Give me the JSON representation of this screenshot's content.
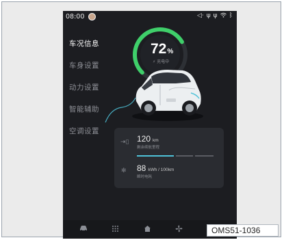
{
  "status_bar": {
    "time": "08:00",
    "icons": [
      "volume-icon",
      "usb-icon",
      "usb-icon",
      "wifi-icon",
      "bluetooth-icon"
    ]
  },
  "sidebar": {
    "items": [
      {
        "label": "车况信息",
        "active": true
      },
      {
        "label": "车身设置",
        "active": false
      },
      {
        "label": "动力设置",
        "active": false
      },
      {
        "label": "智能辅助",
        "active": false
      },
      {
        "label": "空调设置",
        "active": false
      }
    ]
  },
  "battery": {
    "percent": "72",
    "percent_unit": "%",
    "status": "⚡ 充电中",
    "level": 0.72
  },
  "info": {
    "range_value": "120",
    "range_unit": "km",
    "range_label": "剩余续航里程",
    "consumption_value": "88",
    "consumption_unit": "kWh / 100km",
    "consumption_label": "瞬时电耗"
  },
  "bottom_bar": {
    "icons": [
      "car-icon",
      "apps-grid-icon",
      "home-icon",
      "fan-icon",
      "settings-icon"
    ]
  },
  "caption": "OMS51-1036",
  "colors": {
    "accent_teal": "#4fc3d9",
    "gauge_green": "#3fcf6a",
    "screen_bg": "#1c1d21",
    "card_bg": "#2a2c31"
  }
}
